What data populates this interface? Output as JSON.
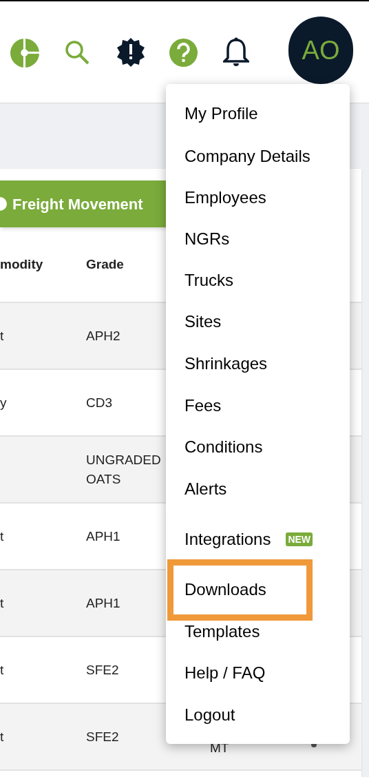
{
  "header": {
    "avatar": {
      "initials": "AO"
    }
  },
  "action_button": {
    "label": "Freight Movement"
  },
  "table": {
    "columns": [
      "modity",
      "Grade"
    ],
    "rows": [
      {
        "cells": [
          "t",
          "APH2"
        ]
      },
      {
        "cells": [
          "y",
          "CD3"
        ]
      },
      {
        "cells": [
          "",
          "UNGRADED OATS"
        ]
      },
      {
        "cells": [
          "t",
          "APH1"
        ]
      },
      {
        "cells": [
          "t",
          "APH1"
        ]
      },
      {
        "cells": [
          "t",
          "SFE2"
        ]
      },
      {
        "cells": [
          "t",
          "SFE2"
        ],
        "column_3": "MT"
      }
    ]
  },
  "menu": {
    "items": [
      {
        "label": "My Profile",
        "highlighted": false
      },
      {
        "label": "Company Details",
        "highlighted": false
      },
      {
        "label": "Employees",
        "highlighted": false
      },
      {
        "label": "NGRs",
        "highlighted": false
      },
      {
        "label": "Trucks",
        "highlighted": false
      },
      {
        "label": "Sites",
        "highlighted": false
      },
      {
        "label": "Shrinkages",
        "highlighted": false
      },
      {
        "label": "Fees",
        "highlighted": false
      },
      {
        "label": "Conditions",
        "highlighted": false
      },
      {
        "label": "Alerts",
        "highlighted": false
      },
      {
        "label": "Integrations",
        "badge": "NEW",
        "highlighted": false
      },
      {
        "label": "Downloads",
        "highlighted": true
      },
      {
        "label": "Templates",
        "highlighted": false
      },
      {
        "label": "Help / FAQ",
        "highlighted": false
      },
      {
        "label": "Logout",
        "highlighted": false
      }
    ]
  }
}
